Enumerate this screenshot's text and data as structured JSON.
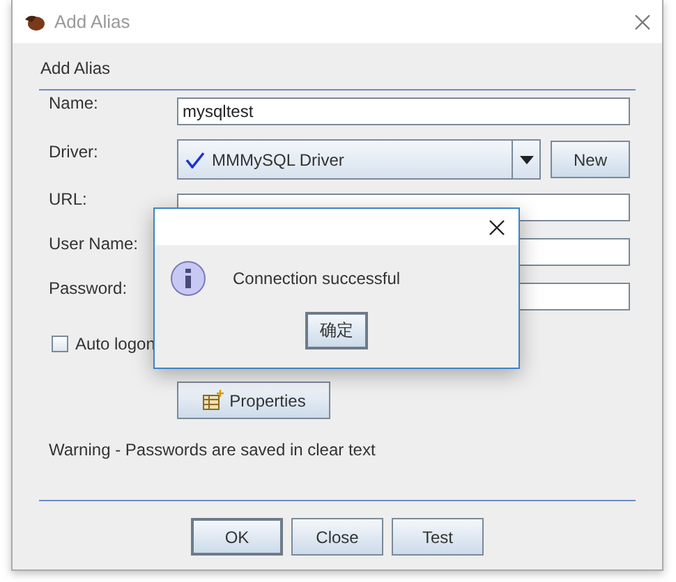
{
  "window": {
    "title": "Add Alias"
  },
  "section_title": "Add Alias",
  "fields": [
    {
      "label": "Name:",
      "kind": "text",
      "value": "mysqltest"
    },
    {
      "label": "Driver:",
      "kind": "combo",
      "value": "MMMySQL Driver",
      "button": "New"
    },
    {
      "label": "URL:",
      "kind": "text"
    },
    {
      "label": "User Name:",
      "kind": "text"
    },
    {
      "label": "Password:",
      "kind": "text"
    }
  ],
  "auto_logon": {
    "label": "Auto logon",
    "checked": false
  },
  "properties_button": "Properties",
  "warning": "Warning - Passwords are saved in clear text",
  "buttons": [
    {
      "label": "OK",
      "default": true
    },
    {
      "label": "Close",
      "default": false
    },
    {
      "label": "Test",
      "default": false
    }
  ],
  "message_dialog": {
    "message": "Connection successful",
    "button": "确定"
  }
}
